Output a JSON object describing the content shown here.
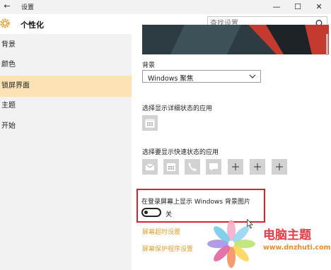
{
  "window": {
    "back_icon": "back-arrow-icon",
    "title": "设置",
    "controls": [
      "minimize-icon",
      "maximize-icon",
      "close-icon"
    ]
  },
  "header": {
    "icon": "gear-icon",
    "title": "个性化",
    "search": {
      "placeholder": "查找设置",
      "icon": "search-icon"
    }
  },
  "sidebar": {
    "items": [
      {
        "label": "背景",
        "active": false
      },
      {
        "label": "颜色",
        "active": false
      },
      {
        "label": "锁屏界面",
        "active": true
      },
      {
        "label": "主题",
        "active": false
      },
      {
        "label": "开始",
        "active": false
      }
    ]
  },
  "main": {
    "background_label": "背景",
    "background_value": "Windows 聚焦",
    "detail_app_label": "选择显示详细状态的应用",
    "quick_app_label": "选择要显示快速状态的应用",
    "quick_apps": [
      "mail-icon",
      "calendar-icon",
      "phone-icon",
      "message-icon",
      "plus-icon",
      "plus-icon",
      "plus-icon"
    ],
    "signin_label": "在登录屏幕上显示 Windows 背景图片",
    "toggle_state": "关",
    "links": [
      "屏幕超时设置",
      "屏幕保护程序设置"
    ]
  },
  "watermark": {
    "text": "电脑主题",
    "url": "www.dnzhuti.com"
  },
  "colors": {
    "accent": "#e0a030",
    "highlight": "#d9252a",
    "active_bg": "#fce2b4"
  }
}
